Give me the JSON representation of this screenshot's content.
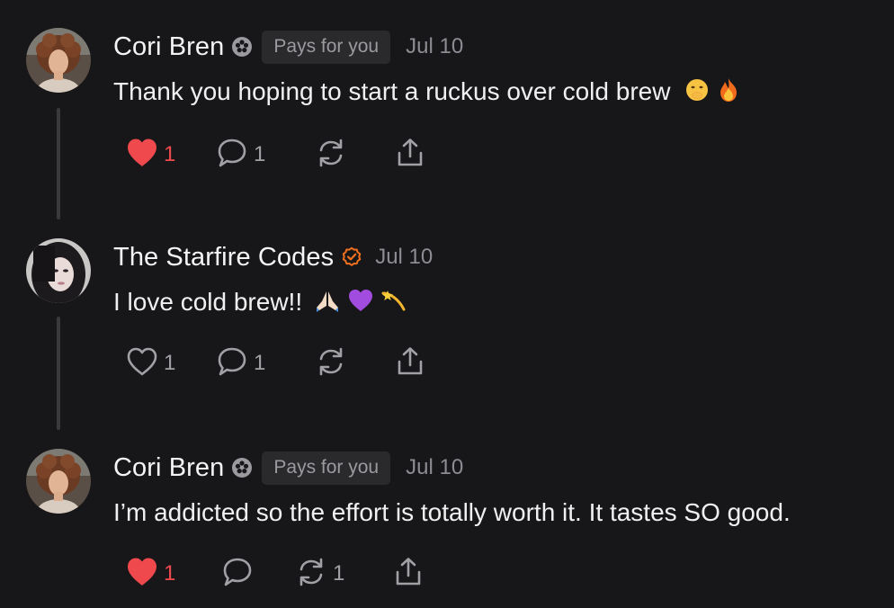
{
  "comments": [
    {
      "author": "Cori Bren",
      "badge_icon": "subscriber-flower-icon",
      "pill": "Pays for you",
      "date": "Jul 10",
      "text": "Thank you hoping to start a ruckus over cold brew",
      "emojis": [
        "face-with-hand-over-mouth",
        "fire"
      ],
      "likes": "1",
      "liked": true,
      "replies": "1",
      "restacks": "",
      "heart_color": "#f0494d"
    },
    {
      "author": "The Starfire Codes",
      "badge_icon": "orange-check-badge-icon",
      "pill": "",
      "date": "Jul 10",
      "text": "I love cold brew!!",
      "emojis": [
        "folded-hands",
        "purple-heart",
        "dizzy"
      ],
      "likes": "1",
      "liked": false,
      "replies": "1",
      "restacks": ""
    },
    {
      "author": "Cori Bren",
      "badge_icon": "subscriber-flower-icon",
      "pill": "Pays for you",
      "date": "Jul 10",
      "text": "I’m addicted so the effort is totally worth it. It tastes SO good.",
      "emojis": [],
      "likes": "1",
      "liked": true,
      "replies": "",
      "restacks": "1"
    }
  ],
  "colors": {
    "background": "#17171a",
    "accent_like": "#f0494d",
    "verified_orange": "#f0701e",
    "muted": "#8c8c92"
  }
}
